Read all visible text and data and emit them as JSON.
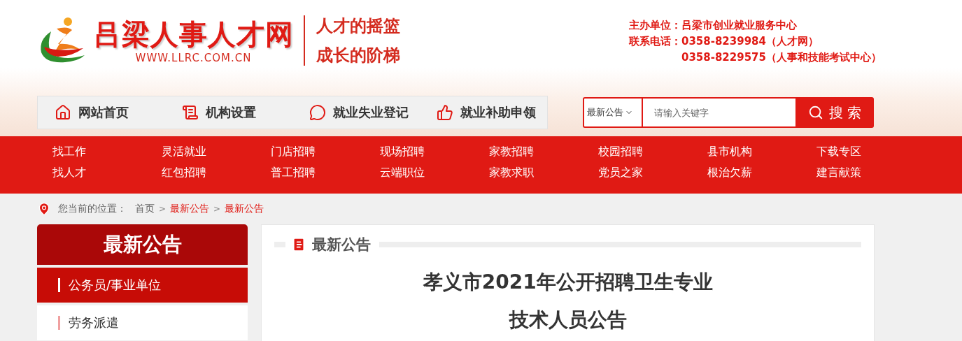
{
  "header": {
    "site_name": "吕梁人事人才网",
    "url": "WWW.LLRC.COM.CN",
    "slogans": [
      "人才的摇篮",
      "成长的阶梯"
    ],
    "contact": [
      {
        "label": "主办单位：",
        "value": "吕梁市创业就业服务中心"
      },
      {
        "label": "联系电话：",
        "value": "0358-8239984（人才网）"
      },
      {
        "value": "0358-8229575（人事和技能考试中心）"
      }
    ]
  },
  "nav": [
    {
      "label": "网站首页"
    },
    {
      "label": "机构设置"
    },
    {
      "label": "就业失业登记"
    },
    {
      "label": "就业补助申领"
    }
  ],
  "search": {
    "category": "最新公告",
    "placeholder": "请输入关键字",
    "button": "搜 索"
  },
  "menu": [
    [
      "找工作",
      "找人才"
    ],
    [
      "灵活就业",
      "红包招聘"
    ],
    [
      "门店招聘",
      "普工招聘"
    ],
    [
      "现场招聘",
      "云端职位"
    ],
    [
      "家教招聘",
      "家教求职"
    ],
    [
      "校园招聘",
      "党员之家"
    ],
    [
      "县市机构",
      "根治欠薪"
    ],
    [
      "下载专区",
      "建言献策"
    ]
  ],
  "breadcrumb": {
    "label": "您当前的位置：",
    "separators": [
      ">",
      ">"
    ],
    "items": [
      {
        "text": "首页",
        "current": false
      },
      {
        "text": "最新公告",
        "current": true
      },
      {
        "text": "最新公告",
        "current": true
      }
    ]
  },
  "sidebar": {
    "title": "最新公告",
    "items": [
      {
        "label": "公务员/事业单位",
        "selected": true
      },
      {
        "label": "劳务派遣",
        "selected": false
      }
    ]
  },
  "article": {
    "section": "最新公告",
    "title_lines": [
      "孝义市2021年公开招聘卫生专业",
      "技术人员公告"
    ]
  }
}
